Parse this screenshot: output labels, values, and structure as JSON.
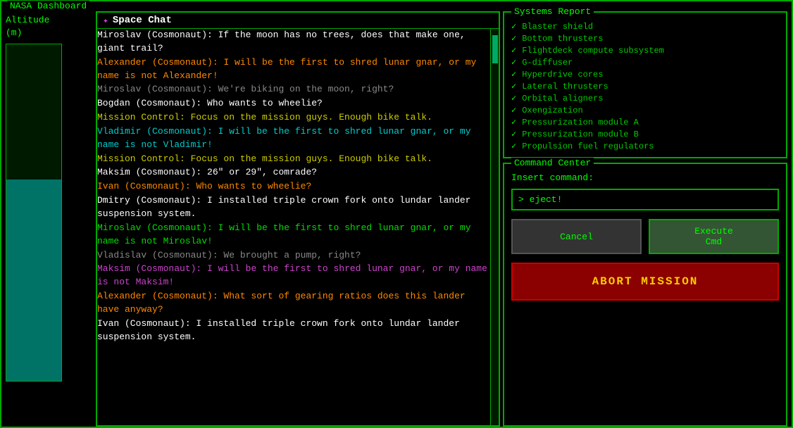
{
  "outer": {
    "title": "NASA Dashboard"
  },
  "altitude": {
    "label": "Altitude",
    "unit": "(m)",
    "fill_percent": 60
  },
  "chat": {
    "title": "Space Chat",
    "icon": "✦",
    "messages": [
      {
        "id": 1,
        "color": "white",
        "parts": [
          {
            "text": "Miroslav (Cosmonaut): If the moon has no trees, does that make one, giant trail?",
            "color": "white"
          }
        ]
      },
      {
        "id": 2,
        "color": "orange",
        "parts": [
          {
            "text": "Alexander (Cosmonaut): ",
            "color": "orange"
          },
          {
            "text": "I will be the first to shred lunar gnar, or my name is not Alexander!",
            "color": "orange"
          }
        ]
      },
      {
        "id": 3,
        "color": "gray",
        "parts": [
          {
            "text": "Miroslav (Cosmonaut): We're biking on the moon, right?",
            "color": "gray"
          }
        ]
      },
      {
        "id": 4,
        "color": "white",
        "parts": [
          {
            "text": "Bogdan (Cosmonaut): Who wants to wheelie?",
            "color": "white"
          }
        ]
      },
      {
        "id": 5,
        "color": "yellow",
        "parts": [
          {
            "text": "Mission Control: Focus on the mission guys. Enough bike talk.",
            "color": "yellow"
          }
        ]
      },
      {
        "id": 6,
        "color": "cyan",
        "parts": [
          {
            "text": "Vladimir (Cosmonaut): ",
            "color": "cyan"
          },
          {
            "text": "I will be the first to shred lunar gnar, or my name is not Vladimir!",
            "color": "cyan"
          }
        ]
      },
      {
        "id": 7,
        "color": "yellow",
        "parts": [
          {
            "text": "Mission Control: Focus on the mission guys. Enough bike talk.",
            "color": "yellow"
          }
        ]
      },
      {
        "id": 8,
        "color": "white",
        "parts": [
          {
            "text": "Maksim (Cosmonaut): 26\" or 29\", comrade?",
            "color": "white"
          }
        ]
      },
      {
        "id": 9,
        "color": "orange",
        "parts": [
          {
            "text": "Ivan (Cosmonaut): ",
            "color": "orange"
          },
          {
            "text": "Who wants to wheelie?",
            "color": "orange"
          }
        ]
      },
      {
        "id": 10,
        "color": "white",
        "parts": [
          {
            "text": "Dmitry (Cosmonaut): I installed triple crown fork onto lundar lander suspension system.",
            "color": "white"
          }
        ]
      },
      {
        "id": 11,
        "color": "green",
        "parts": [
          {
            "text": "Miroslav (Cosmonaut): ",
            "color": "green"
          },
          {
            "text": "I will be the first to shred lunar gnar, or my name is not Miroslav!",
            "color": "green"
          }
        ]
      },
      {
        "id": 12,
        "color": "gray",
        "parts": [
          {
            "text": "Vladislav (Cosmonaut): We brought a pump, right?",
            "color": "gray"
          }
        ]
      },
      {
        "id": 13,
        "color": "purple",
        "parts": [
          {
            "text": "Maksim (Cosmonaut): ",
            "color": "purple"
          },
          {
            "text": "I will be the first to shred lunar gnar, or my name is not Maksim!",
            "color": "purple"
          }
        ]
      },
      {
        "id": 14,
        "color": "orange",
        "parts": [
          {
            "text": "Alexander (Cosmonaut): What sort of gearing ratios does this lander have anyway?",
            "color": "orange"
          }
        ]
      },
      {
        "id": 15,
        "color": "white",
        "parts": [
          {
            "text": "Ivan (Cosmonaut): I installed triple crown fork onto lundar lander suspension system.",
            "color": "white"
          }
        ]
      }
    ]
  },
  "systems": {
    "title": "Systems Report",
    "items": [
      {
        "label": "Blaster shield",
        "status": "ok"
      },
      {
        "label": "Bottom thrusters",
        "status": "ok"
      },
      {
        "label": "Flightdeck compute subsystem",
        "status": "ok"
      },
      {
        "label": "G-diffuser",
        "status": "ok"
      },
      {
        "label": "Hyperdrive cores",
        "status": "ok"
      },
      {
        "label": "Lateral thrusters",
        "status": "ok"
      },
      {
        "label": "Orbital aligners",
        "status": "ok"
      },
      {
        "label": "Oxengization",
        "status": "ok"
      },
      {
        "label": "Pressurization module A",
        "status": "ok"
      },
      {
        "label": "Pressurization module B",
        "status": "ok"
      },
      {
        "label": "Propulsion fuel regulators",
        "status": "ok"
      }
    ]
  },
  "command": {
    "title": "Command Center",
    "insert_label": "Insert command:",
    "input_value": "> eject!",
    "cancel_label": "Cancel",
    "execute_label": "Execute\nCmd",
    "abort_label": "ABORT MISSION"
  }
}
